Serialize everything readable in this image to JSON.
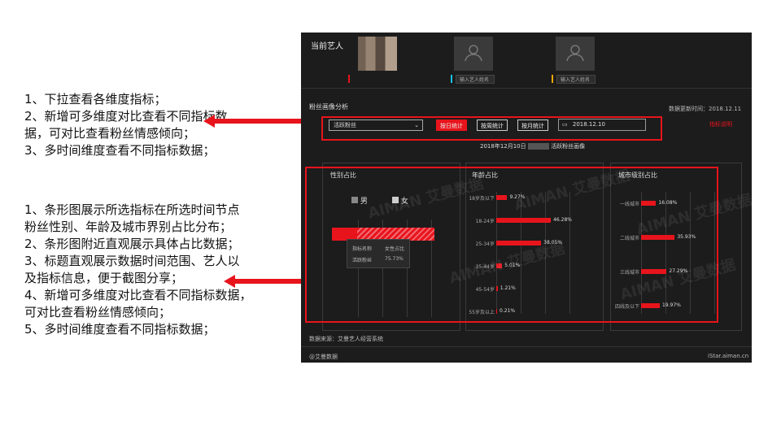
{
  "notes": {
    "block1": "1、下拉查看各维度指标；\n2、新增可多维度对比查看不同指标数\n据，可对比查看粉丝情感倾向；\n3、多时间维度查看不同指标数据；",
    "block2": "1、条形图展示所选指标在所选时间节点\n粉丝性别、年龄及城市界别占比分布；\n2、条形图附近直观展示具体占比数据；\n3、标题直观展示数据时间范围、艺人以\n及指标信息，便于截图分享；\n4、新增可多维度对比查看不同指标数据，\n可对比查看粉丝情感倾向；\n5、多时间维度查看不同指标数据；"
  },
  "shot": {
    "current_artist_label": "当前艺人",
    "input_placeholder": "输入艺人姓名",
    "slot_colors": [
      "#e8141c",
      "#19c3e6",
      "#f2a600"
    ],
    "section_title": "粉丝画像分析",
    "update_time": "数据更新时间：2018.12.11",
    "dropdown_value": "活跃粉丝",
    "buttons": {
      "day": "按日统计",
      "week": "按周统计",
      "month": "按月统计"
    },
    "date_value": "2018.12.10",
    "export_link": "指标说明",
    "subtitle_left": "2018年12月10日",
    "subtitle_right": "活跃粉丝画像",
    "gender": {
      "title": "性别占比",
      "legend_male": "男",
      "legend_female": "女",
      "male_pct": 0.2427,
      "female_pct": 0.7573,
      "tooltip_h1": "指标名称",
      "tooltip_h2": "女性占比",
      "tooltip_v1": "活跃粉丝",
      "tooltip_v2": "75.73%"
    },
    "age": {
      "title": "年龄占比",
      "labels": [
        "18岁及以下",
        "18-24岁",
        "25-34岁",
        "35-44岁",
        "45-54岁",
        "55岁及以上"
      ],
      "values_text": [
        "9.27%",
        "46.28%",
        "38.05%",
        "5.01%",
        "1.21%",
        "0.21%"
      ],
      "values": [
        9.27,
        46.28,
        38.05,
        5.01,
        1.21,
        0.21
      ]
    },
    "city": {
      "title": "城市级别占比",
      "labels": [
        "一线城市",
        "二线城市",
        "三线城市",
        "四线及以下"
      ],
      "values_text": [
        "16.08%",
        "35.93%",
        "27.29%",
        "19.97%"
      ],
      "values": [
        16.08,
        35.93,
        27.29,
        19.97
      ]
    },
    "data_source": "数据来源：艾曼艺人经营系统",
    "footer_left": "@艾曼数据",
    "footer_right": "iStar.aiman.cn",
    "watermark": "AIMAN 艾曼数据"
  }
}
